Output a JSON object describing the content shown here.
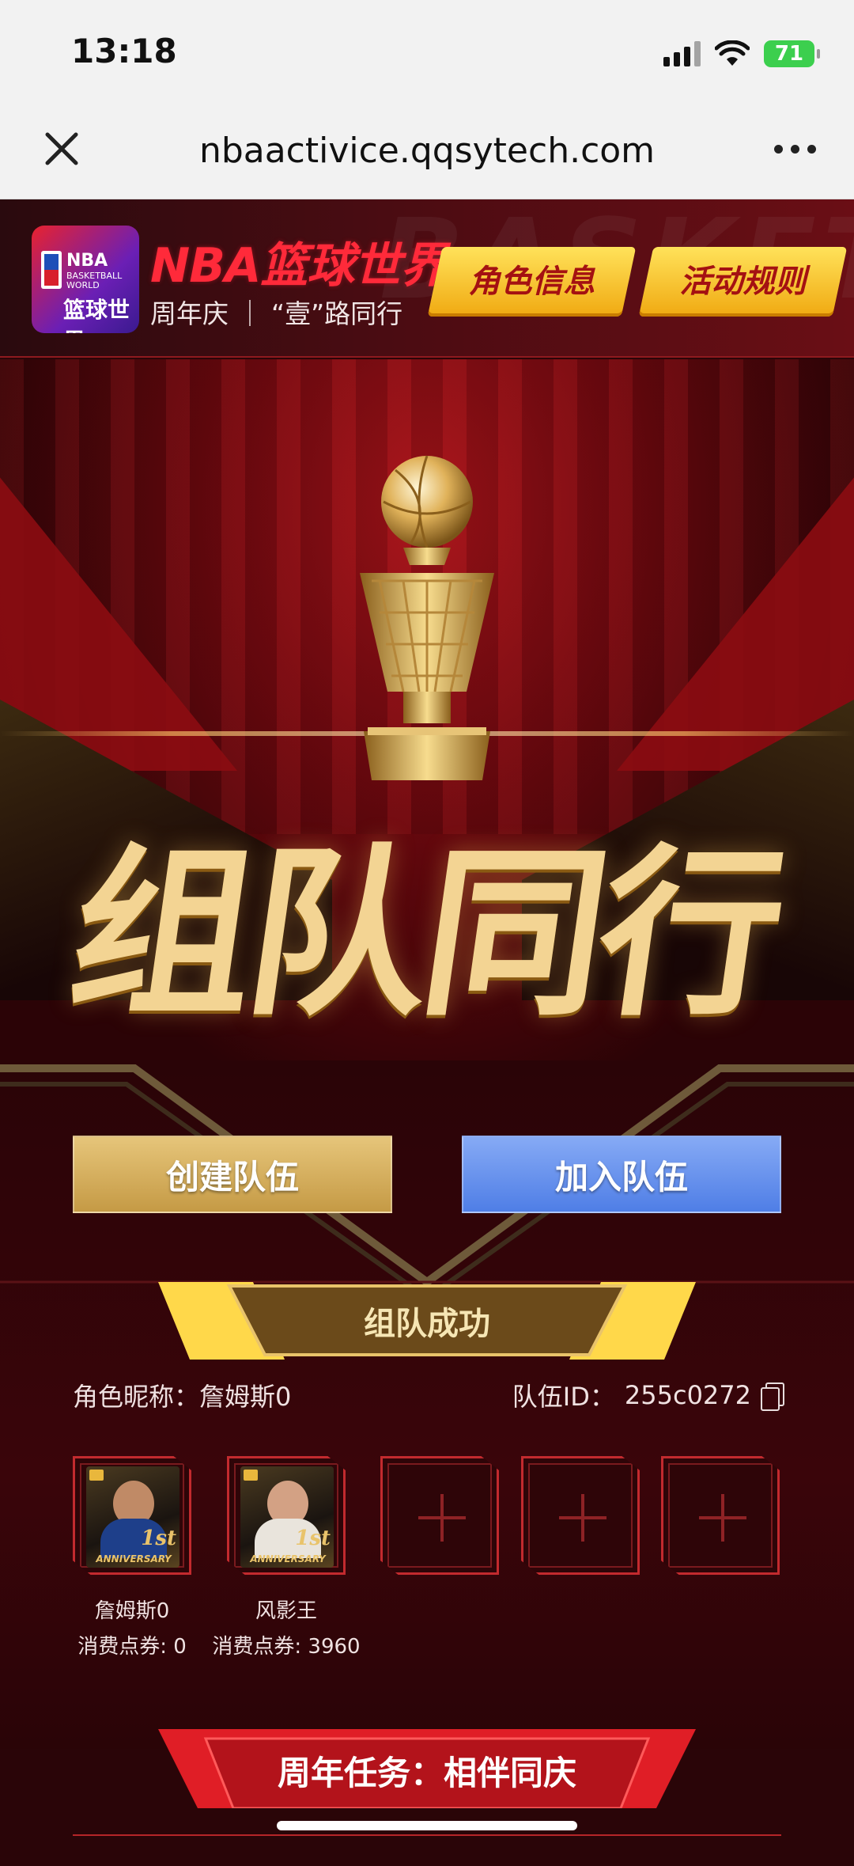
{
  "status_bar": {
    "time": "13:18",
    "battery": "71"
  },
  "browser": {
    "url": "nbaactivice.qqsytech.com"
  },
  "header": {
    "brand_title": "NBA篮球世界",
    "brand_subtitle": "周年庆 ｜ “壹”路同行",
    "logo_line1": "NBA",
    "logo_line2": "BASKETBALL WORLD",
    "logo_line3": "篮球世界",
    "role_info_button": "角色信息",
    "rules_button": "活动规则",
    "bg_word": "BASKETBA"
  },
  "hero": {
    "title": "组队同行"
  },
  "team": {
    "create_button": "创建队伍",
    "join_button": "加入队伍",
    "status_banner": "组队成功",
    "nickname_label": "角色昵称：",
    "nickname_value": "詹姆斯0",
    "team_id_label": "队伍ID：",
    "team_id_value": "255c0272",
    "members": [
      {
        "name": "詹姆斯0",
        "cost": "消费点券: 0",
        "badge": "1st",
        "anniversary": "ANNIVERSARY"
      },
      {
        "name": "风影王",
        "cost": "消费点券: 3960",
        "badge": "1st",
        "anniversary": "ANNIVERSARY"
      }
    ]
  },
  "footer": {
    "task_banner": "周年任务：相伴同庆"
  },
  "colors": {
    "accent_red": "#ff2a3a",
    "gold_button": "#f0a911",
    "create_gold": "#c59a45",
    "join_blue": "#4f7ee6",
    "slot_border": "#c22a2e"
  },
  "icons": [
    "close-icon",
    "more-icon",
    "signal-icon",
    "wifi-icon",
    "battery-icon",
    "copy-icon",
    "plus-icon",
    "trophy-icon"
  ]
}
